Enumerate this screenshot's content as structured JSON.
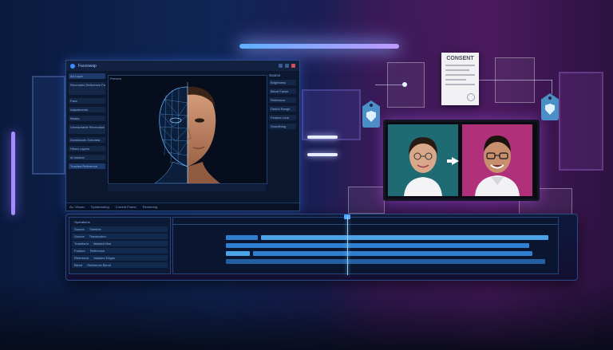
{
  "editor": {
    "title": "Faceswap",
    "preview_label": "Preview",
    "right_header": "Source",
    "left_items": [
      "Ad Layer",
      "Recreated Reference Face",
      "Face",
      "Adjustments",
      "Masks",
      "Unreachable Recreation",
      "Downloads Overview",
      "Filters Layers",
      "Ai tracked",
      "Tracked Reference"
    ],
    "right_items": [
      "Brightness",
      "Blend Factor",
      "Reference",
      "Detect Range",
      "Feature Lock",
      "Smoothing"
    ],
    "status_items": [
      "Ac: Viewer",
      "Synthesizing",
      "Current Frame",
      "Rendering"
    ]
  },
  "consent": {
    "title": "CONSENT"
  },
  "timeline": {
    "left_header": "Operations",
    "tracks": [
      {
        "name": "Source",
        "value": "Timeline"
      },
      {
        "name": "Source",
        "value": "Transcoded"
      },
      {
        "name": "Transform",
        "value": "Masked Blur"
      },
      {
        "name": "Feature",
        "value": "Reference"
      },
      {
        "name": "Reference",
        "value": "Masked Edges"
      },
      {
        "name": "Blend",
        "value": "Reference Blend"
      },
      {
        "name": "Blending",
        "value": "Reference"
      },
      {
        "name": "Output",
        "value": "Output"
      }
    ]
  },
  "colors": {
    "accent_blue": "#3f8cff",
    "accent_purple": "#a77dff",
    "face_left_bg": "#1f6b74",
    "face_right_bg": "#b0307a"
  }
}
